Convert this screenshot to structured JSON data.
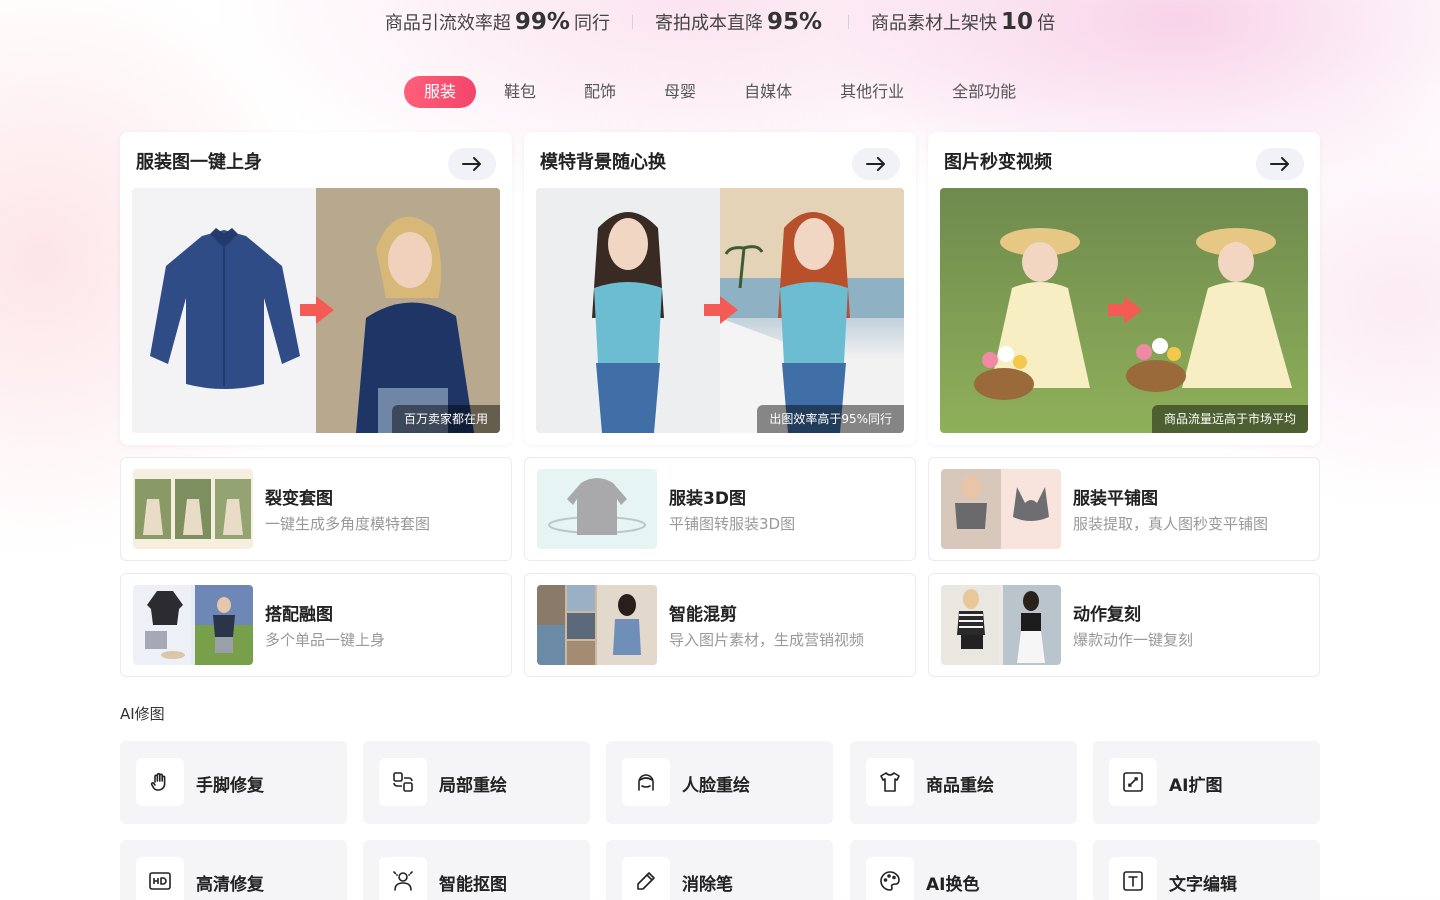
{
  "stats": [
    {
      "prefix": "商品引流效率超",
      "value": "99%",
      "suffix": "同行"
    },
    {
      "prefix": "寄拍成本直降",
      "value": "95%",
      "suffix": ""
    },
    {
      "prefix": "商品素材上架快",
      "value": "10",
      "suffix": "倍"
    }
  ],
  "tabs": [
    {
      "label": "服装",
      "active": true
    },
    {
      "label": "鞋包"
    },
    {
      "label": "配饰"
    },
    {
      "label": "母婴"
    },
    {
      "label": "自媒体"
    },
    {
      "label": "其他行业"
    },
    {
      "label": "全部功能"
    }
  ],
  "features": [
    {
      "title": "服装图一键上身",
      "caption": "百万卖家都在用",
      "icon": "arrow-right-icon"
    },
    {
      "title": "模特背景随心换",
      "caption": "出图效率高于95%同行",
      "icon": "arrow-right-icon"
    },
    {
      "title": "图片秒变视频",
      "caption": "商品流量远高于市场平均",
      "icon": "arrow-right-icon"
    }
  ],
  "tools": [
    {
      "title": "裂变套图",
      "desc": "一键生成多角度模特套图"
    },
    {
      "title": "服装3D图",
      "desc": "平铺图转服装3D图"
    },
    {
      "title": "服装平铺图",
      "desc": "服装提取，真人图秒变平铺图"
    },
    {
      "title": "搭配融图",
      "desc": "多个单品一键上身"
    },
    {
      "title": "智能混剪",
      "desc": "导入图片素材，生成营销视频"
    },
    {
      "title": "动作复刻",
      "desc": "爆款动作一键复刻"
    }
  ],
  "ai_section": {
    "title": "AI修图",
    "items": [
      {
        "label": "手脚修复",
        "icon": "hand-icon"
      },
      {
        "label": "局部重绘",
        "icon": "partial-redraw-icon"
      },
      {
        "label": "人脸重绘",
        "icon": "face-icon"
      },
      {
        "label": "商品重绘",
        "icon": "tshirt-icon"
      },
      {
        "label": "AI扩图",
        "icon": "expand-icon"
      },
      {
        "label": "高清修复",
        "icon": "hd-icon"
      },
      {
        "label": "智能抠图",
        "icon": "cutout-icon"
      },
      {
        "label": "消除笔",
        "icon": "pen-icon"
      },
      {
        "label": "AI换色",
        "icon": "palette-icon"
      },
      {
        "label": "文字编辑",
        "icon": "text-icon"
      }
    ]
  },
  "colors": {
    "accent": "#f2456a",
    "card_bg": "#ffffff",
    "tool_bg": "#f5f5f7"
  }
}
